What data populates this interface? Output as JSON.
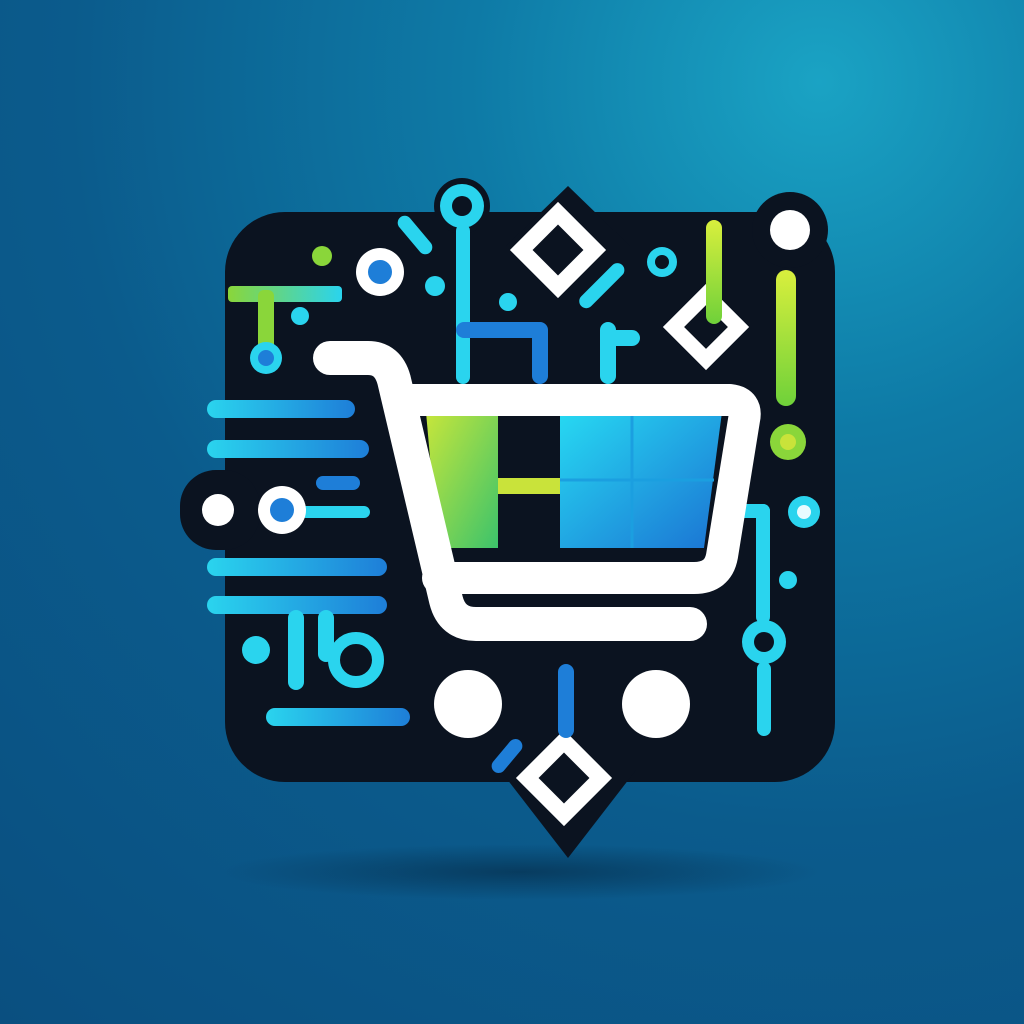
{
  "icon": {
    "subject": "shopping-cart-icon",
    "style": "circuit-board-logo"
  },
  "colors": {
    "background_light": "#1aa3c4",
    "background_dark": "#0a4f80",
    "tile": "#0b1320",
    "accent_cyan": "#2ad4ee",
    "accent_blue": "#1e7ed8",
    "accent_green": "#8ad63a",
    "accent_lime": "#c9e33a",
    "cart_white": "#ffffff"
  }
}
